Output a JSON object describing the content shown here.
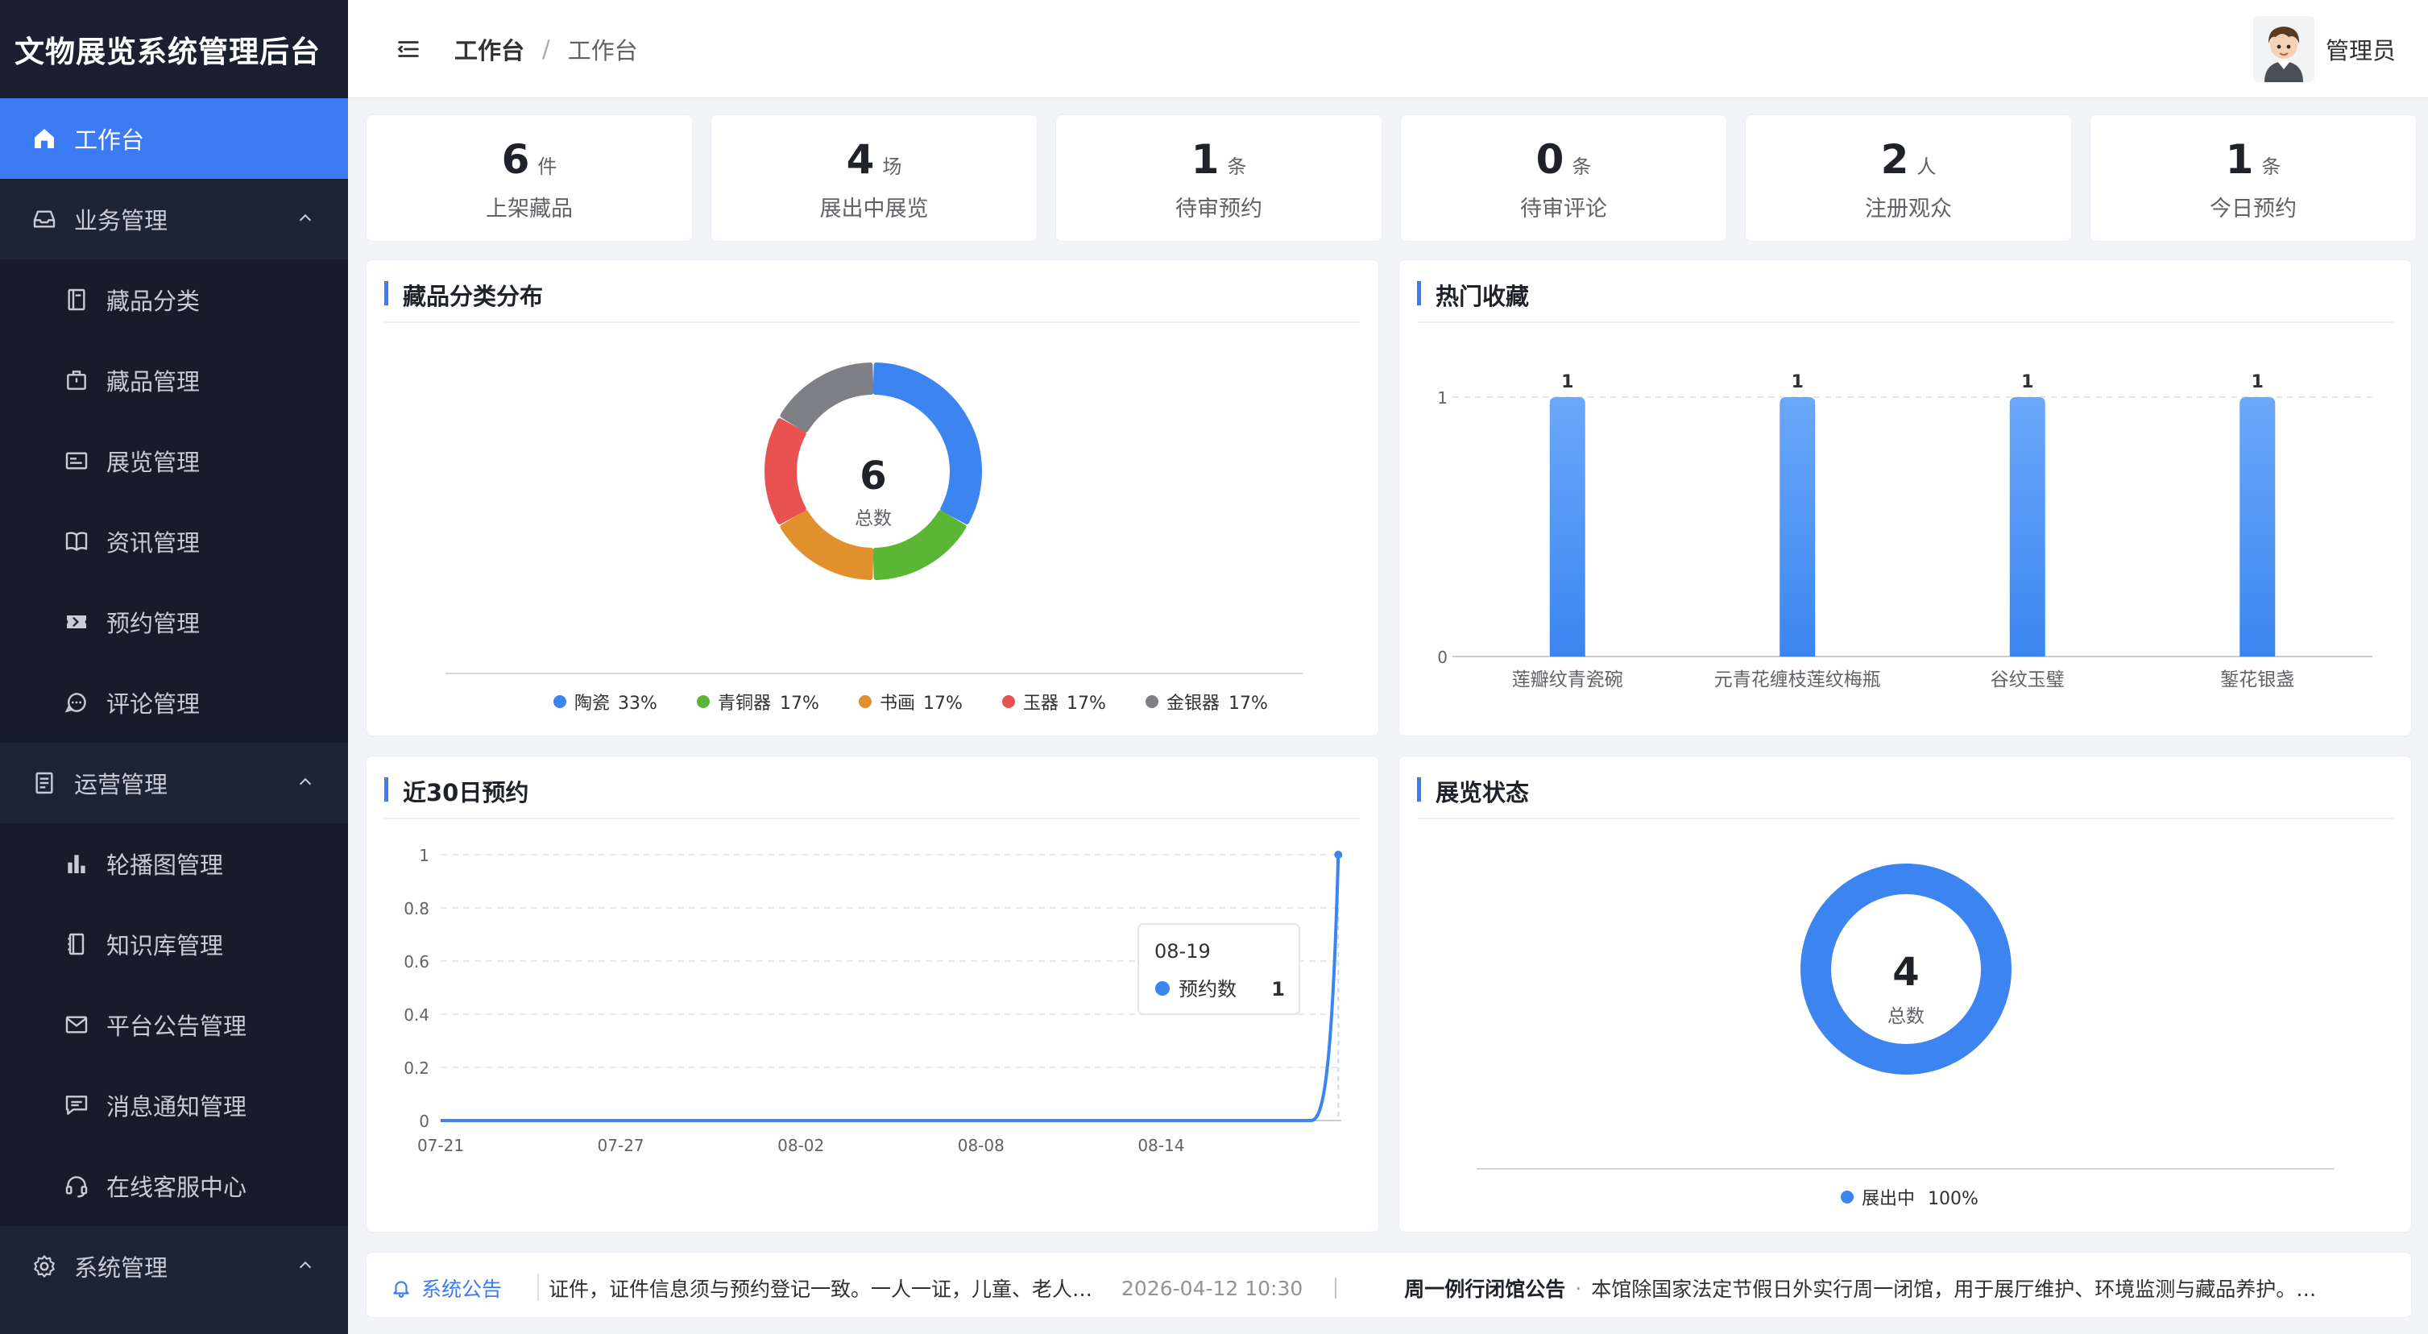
{
  "app_title": "文物展览系统管理后台",
  "header": {
    "breadcrumb": [
      "工作台",
      "工作台"
    ],
    "breadcrumb_sep": "/",
    "user_name": "管理员"
  },
  "sidebar": {
    "items": [
      {
        "label": "工作台",
        "icon": "home-icon",
        "level": "top",
        "active": true
      },
      {
        "label": "业务管理",
        "icon": "inbox-icon",
        "level": "top",
        "expanded": true
      },
      {
        "label": "藏品分类",
        "icon": "notebook-icon",
        "level": "sub"
      },
      {
        "label": "藏品管理",
        "icon": "briefcase-icon",
        "level": "sub"
      },
      {
        "label": "展览管理",
        "icon": "postcard-icon",
        "level": "sub"
      },
      {
        "label": "资讯管理",
        "icon": "book-icon",
        "level": "sub"
      },
      {
        "label": "预约管理",
        "icon": "ticket-icon",
        "level": "sub"
      },
      {
        "label": "评论管理",
        "icon": "chat-icon",
        "level": "sub"
      },
      {
        "label": "运营管理",
        "icon": "document-icon",
        "level": "top",
        "expanded": true
      },
      {
        "label": "轮播图管理",
        "icon": "histogram-icon",
        "level": "sub"
      },
      {
        "label": "知识库管理",
        "icon": "reading-icon",
        "level": "sub"
      },
      {
        "label": "平台公告管理",
        "icon": "message-icon",
        "level": "sub"
      },
      {
        "label": "消息通知管理",
        "icon": "chat-square-icon",
        "level": "sub"
      },
      {
        "label": "在线客服中心",
        "icon": "headset-icon",
        "level": "sub"
      },
      {
        "label": "系统管理",
        "icon": "setting-icon",
        "level": "top",
        "expanded": true
      }
    ]
  },
  "stats": [
    {
      "value": "6",
      "unit": "件",
      "label": "上架藏品"
    },
    {
      "value": "4",
      "unit": "场",
      "label": "展出中展览"
    },
    {
      "value": "1",
      "unit": "条",
      "label": "待审预约"
    },
    {
      "value": "0",
      "unit": "条",
      "label": "待审评论"
    },
    {
      "value": "2",
      "unit": "人",
      "label": "注册观众"
    },
    {
      "value": "1",
      "unit": "条",
      "label": "今日预约"
    }
  ],
  "panels": {
    "category": "藏品分类分布",
    "hot": "热门收藏",
    "recent": "近30日预约",
    "status": "展览状态"
  },
  "chart_data": [
    {
      "type": "pie",
      "title": "藏品分类分布",
      "center_value": "6",
      "center_label": "总数",
      "slices": [
        {
          "name": "陶瓷",
          "value": 2,
          "pct": "33%",
          "color": "#3c85f0"
        },
        {
          "name": "青铜器",
          "value": 1,
          "pct": "17%",
          "color": "#5ab634"
        },
        {
          "name": "书画",
          "value": 1,
          "pct": "17%",
          "color": "#e0902c"
        },
        {
          "name": "玉器",
          "value": 1,
          "pct": "17%",
          "color": "#ea5252"
        },
        {
          "name": "金银器",
          "value": 1,
          "pct": "17%",
          "color": "#7e8085"
        }
      ]
    },
    {
      "type": "bar",
      "title": "热门收藏",
      "categories": [
        "莲瓣纹青瓷碗",
        "元青花缠枝莲纹梅瓶",
        "谷纹玉璧",
        "錾花银盏"
      ],
      "values": [
        1,
        1,
        1,
        1
      ],
      "ylim": [
        0,
        1
      ],
      "yticks": [
        "0",
        "1"
      ],
      "color": "#3c85f0"
    },
    {
      "type": "line",
      "title": "近30日预约",
      "series": [
        {
          "name": "预约数",
          "color": "#3c85f0"
        }
      ],
      "x_ticks": [
        "07-21",
        "07-27",
        "08-02",
        "08-08",
        "08-14"
      ],
      "yticks": [
        "0",
        "0.2",
        "0.4",
        "0.6",
        "0.8",
        "1"
      ],
      "ylim": [
        0,
        1
      ],
      "points_count": 30,
      "last_point": {
        "x": "08-19",
        "y": 1
      },
      "tooltip": {
        "date": "08-19",
        "series": "预约数",
        "value": "1"
      }
    },
    {
      "type": "pie",
      "title": "展览状态",
      "center_value": "4",
      "center_label": "总数",
      "slices": [
        {
          "name": "展出中",
          "value": 4,
          "pct": "100%",
          "color": "#3c85f0"
        }
      ]
    }
  ],
  "notice": {
    "label": "系统公告",
    "items": [
      {
        "text": "证件，证件信息须与预约登记一致。一人一证，儿童、老人…",
        "time": "2026-04-12 10:30"
      },
      {
        "title": "周一例行闭馆公告",
        "text": "本馆除国家法定节假日外实行周一闭馆，用于展厅维护、环境监测与藏品养护。…"
      }
    ]
  }
}
